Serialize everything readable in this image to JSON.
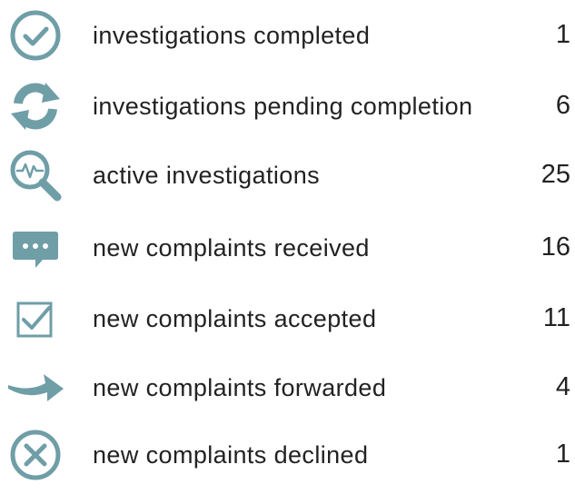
{
  "accent_color": "#6f9ea7",
  "stats": [
    {
      "icon": "check-circle-icon",
      "label": "investigations completed",
      "value": "1"
    },
    {
      "icon": "refresh-arrows-icon",
      "label": "investigations pending completion",
      "value": "6"
    },
    {
      "icon": "magnifier-pulse-icon",
      "label": "active investigations",
      "value": "25"
    },
    {
      "icon": "speech-bubble-icon",
      "label": "new complaints received",
      "value": "16"
    },
    {
      "icon": "checkbox-icon",
      "label": "new complaints accepted",
      "value": "11"
    },
    {
      "icon": "forward-arrow-icon",
      "label": "new complaints forwarded",
      "value": "4"
    },
    {
      "icon": "x-circle-icon",
      "label": "new complaints declined",
      "value": "1"
    }
  ]
}
